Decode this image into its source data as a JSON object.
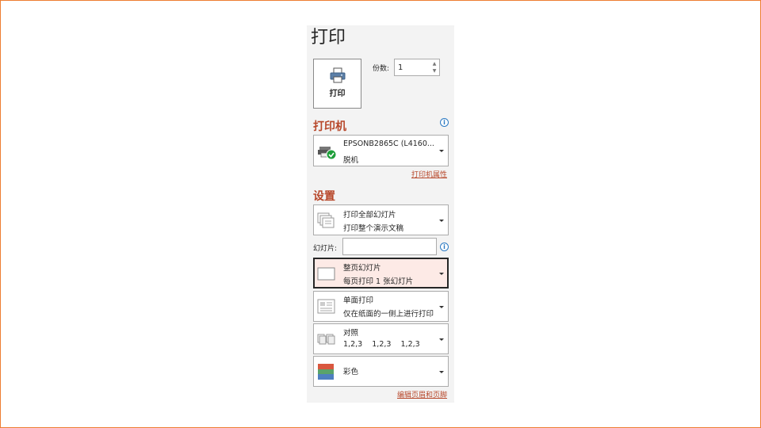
{
  "title": "打印",
  "print_button": {
    "label": "打印",
    "icon": "printer-icon"
  },
  "copies": {
    "label": "份数:",
    "value": "1"
  },
  "printer_section": {
    "heading": "打印机",
    "printer_name": "EPSONB2865C (L4160...",
    "printer_status": "脱机",
    "properties_link": "打印机属性",
    "status_icon_color": "#1e9e3a"
  },
  "settings_section": {
    "heading": "设置",
    "print_range": {
      "line1": "打印全部幻灯片",
      "line2": "打印整个演示文稿"
    },
    "slides": {
      "label": "幻灯片:",
      "value": ""
    },
    "layout": {
      "line1": "整页幻灯片",
      "line2": "每页打印 1 张幻灯片"
    },
    "sides": {
      "line1": "单面打印",
      "line2": "仅在纸面的一侧上进行打印"
    },
    "collate": {
      "line1": "对照",
      "line2": "1,2,3    1,2,3    1,2,3"
    },
    "color": {
      "line1": "彩色"
    },
    "header_footer_link": "编辑页眉和页脚"
  },
  "colors": {
    "accent": "#b7472a",
    "frame": "#ED7D31",
    "panel": "#f3f3f3",
    "selected_bg": "#fdeae6"
  }
}
